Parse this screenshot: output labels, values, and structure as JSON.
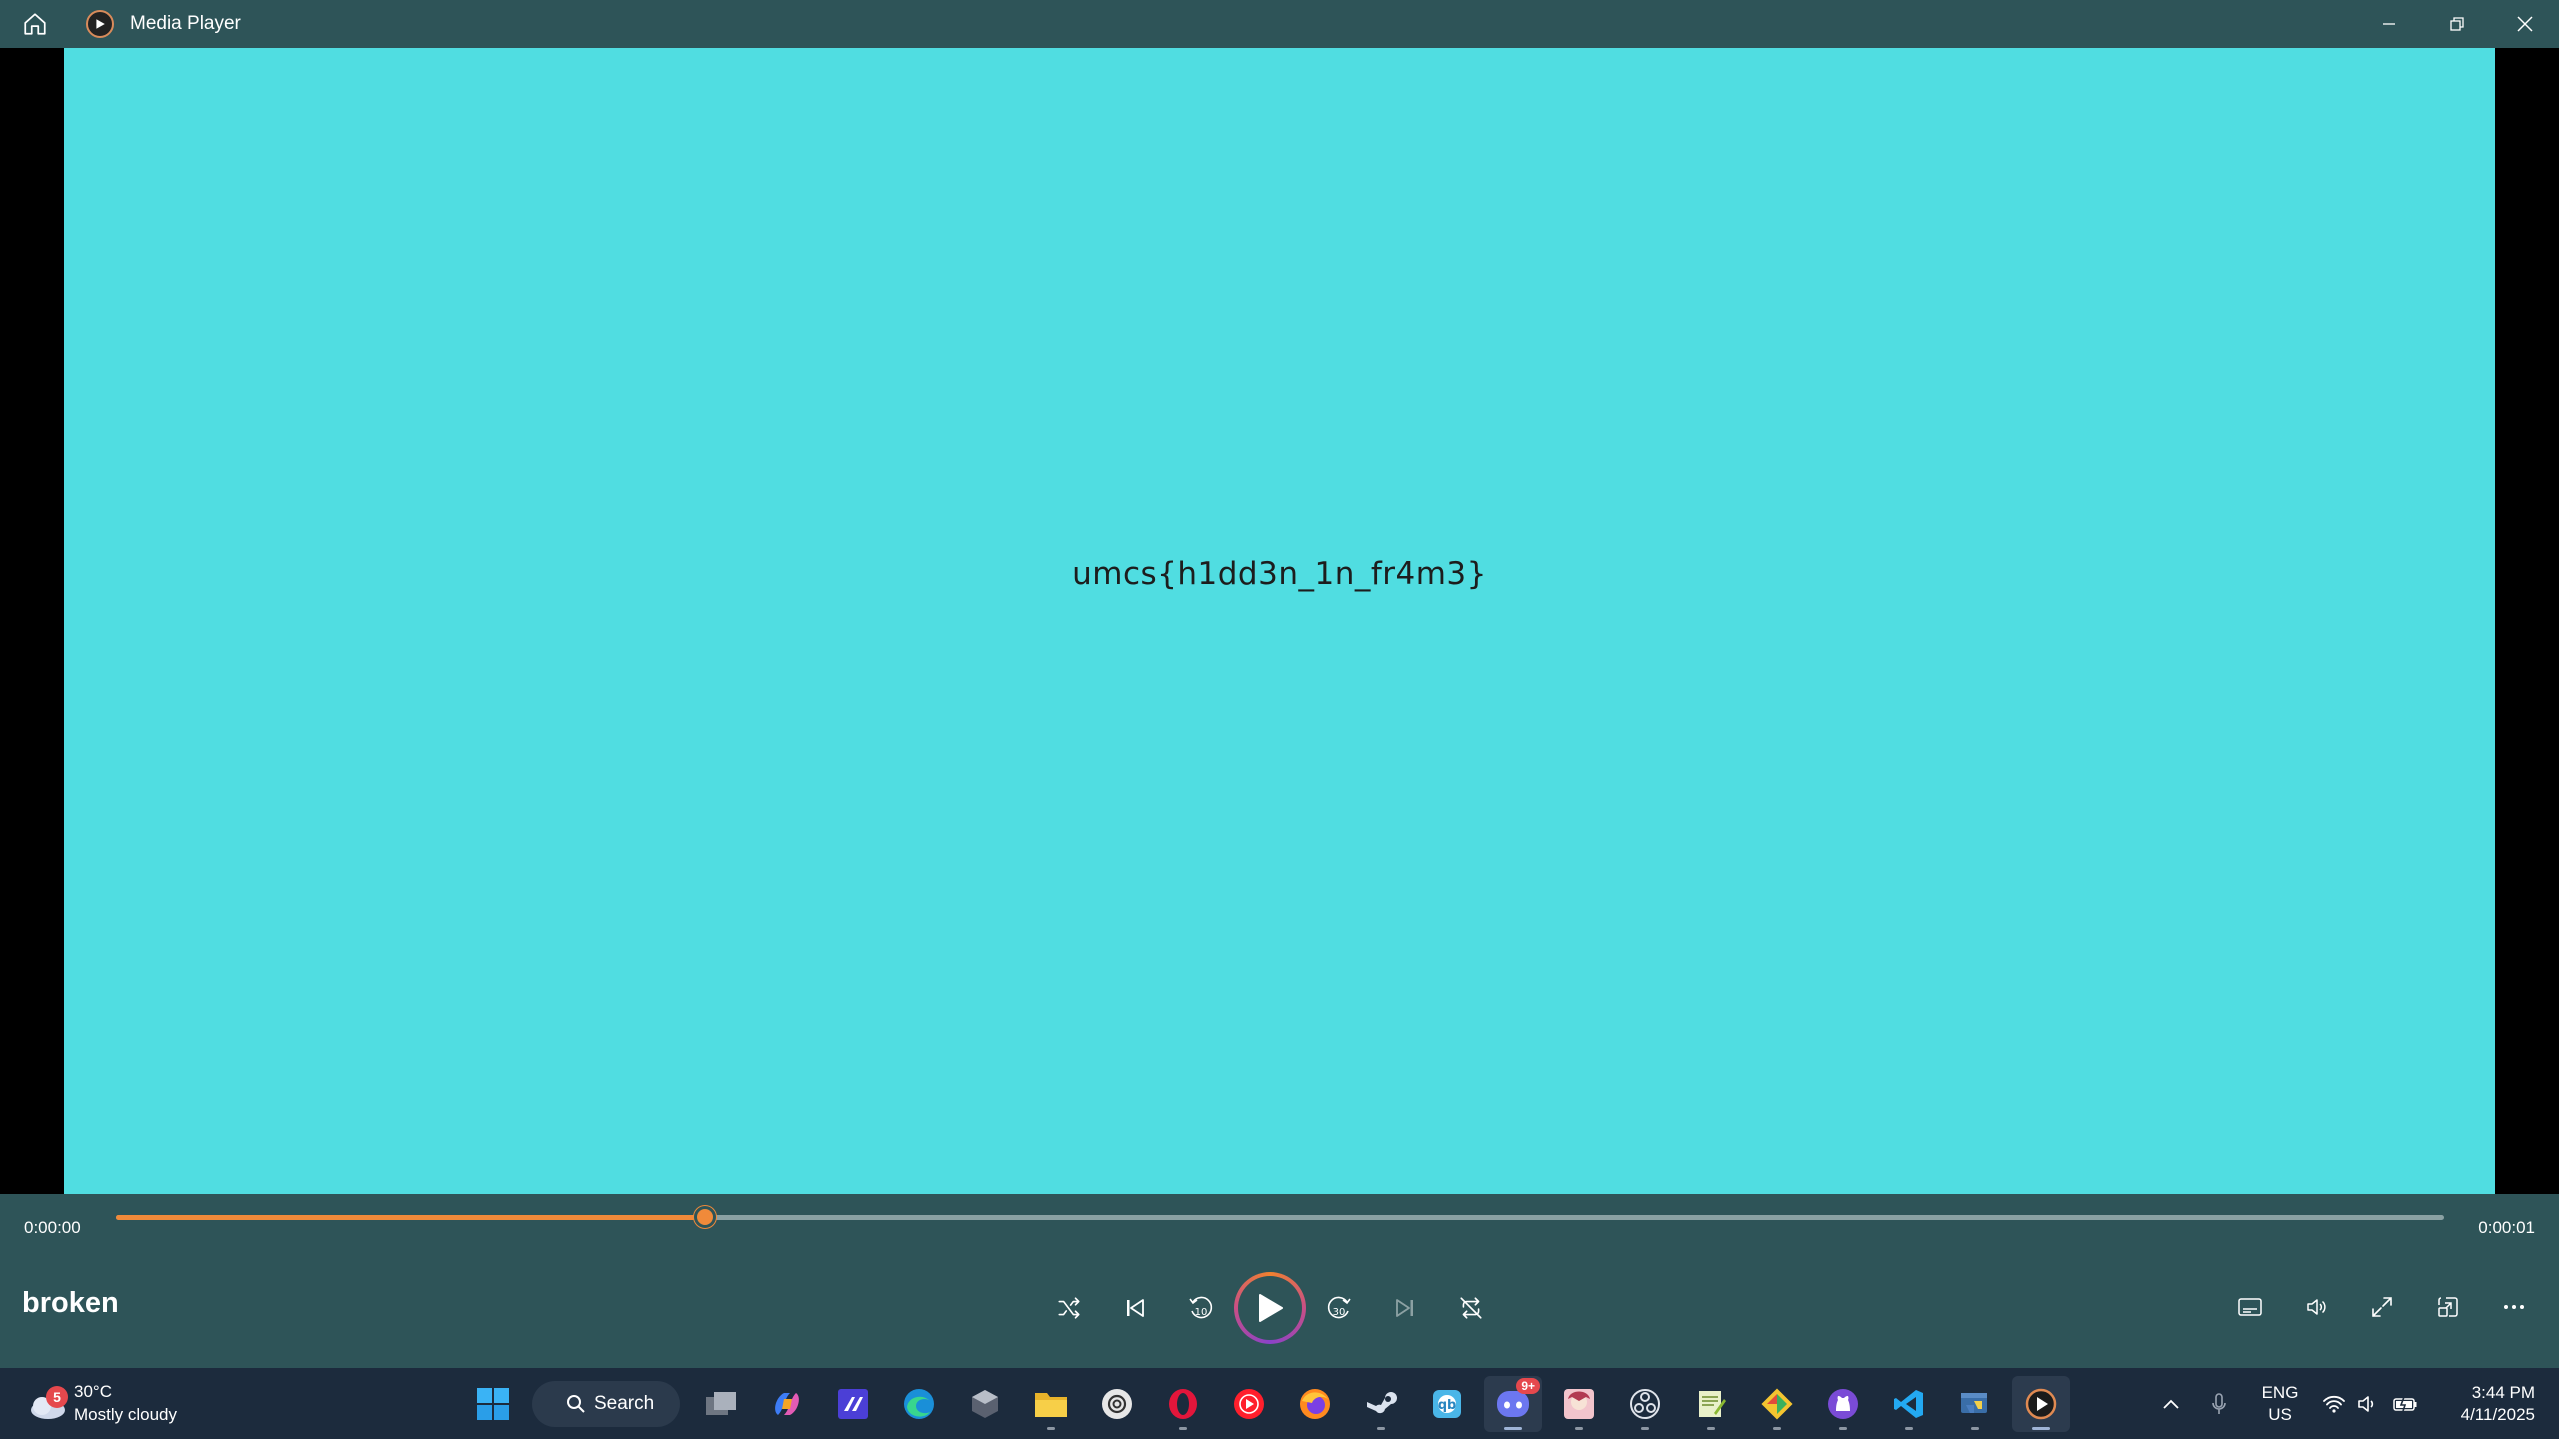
{
  "window": {
    "app_title": "Media Player"
  },
  "video": {
    "overlay_text": "umcs{h1dd3n_1n_fr4m3}"
  },
  "player": {
    "time_elapsed": "0:00:00",
    "time_total": "0:00:01",
    "progress_fraction": 0.253,
    "media_title": "broken",
    "accent_color": "#f08a3a"
  },
  "taskbar": {
    "weather": {
      "badge": "5",
      "temperature": "30°C",
      "condition": "Mostly cloudy"
    },
    "search_label": "Search",
    "apps": [
      "windows-start",
      "search",
      "task-view",
      "copilot",
      "visual-studio",
      "edge",
      "unity",
      "file-explorer",
      "chatgpt",
      "opera",
      "youtube-music",
      "firefox",
      "steam",
      "qbittorrent",
      "discord",
      "anime-app",
      "obs",
      "notepad-plus",
      "git",
      "github",
      "vscode",
      "python",
      "media-player"
    ],
    "discord_badge": "9+",
    "language": {
      "line1": "ENG",
      "line2": "US"
    },
    "clock": {
      "time": "3:44 PM",
      "date": "4/11/2025"
    }
  }
}
